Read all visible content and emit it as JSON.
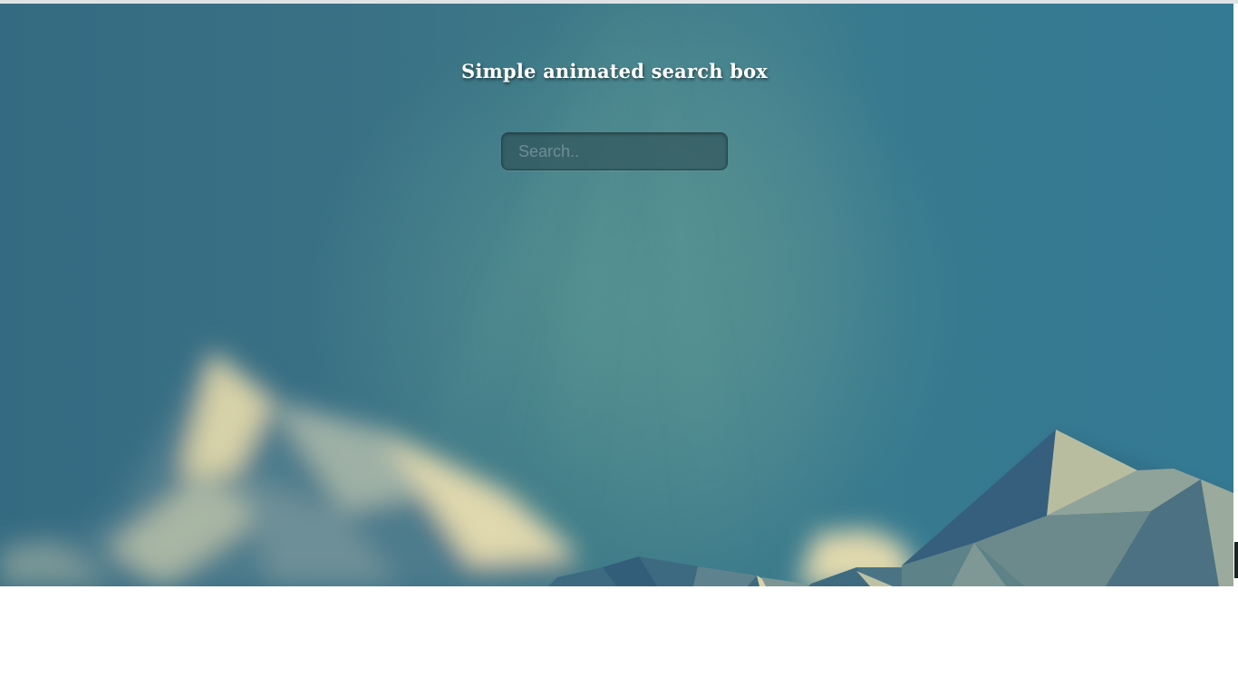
{
  "page": {
    "title": "Simple animated search box"
  },
  "search": {
    "placeholder": "Search..",
    "value": ""
  },
  "colors": {
    "sky_dark": "#356b82",
    "sky_light": "#5a9292",
    "mountain_cream": "#d9d3a8",
    "mountain_slate": "#4a7182",
    "title_text": "#ffffff"
  },
  "icons": {
    "background": "low-poly-mountain-landscape"
  }
}
